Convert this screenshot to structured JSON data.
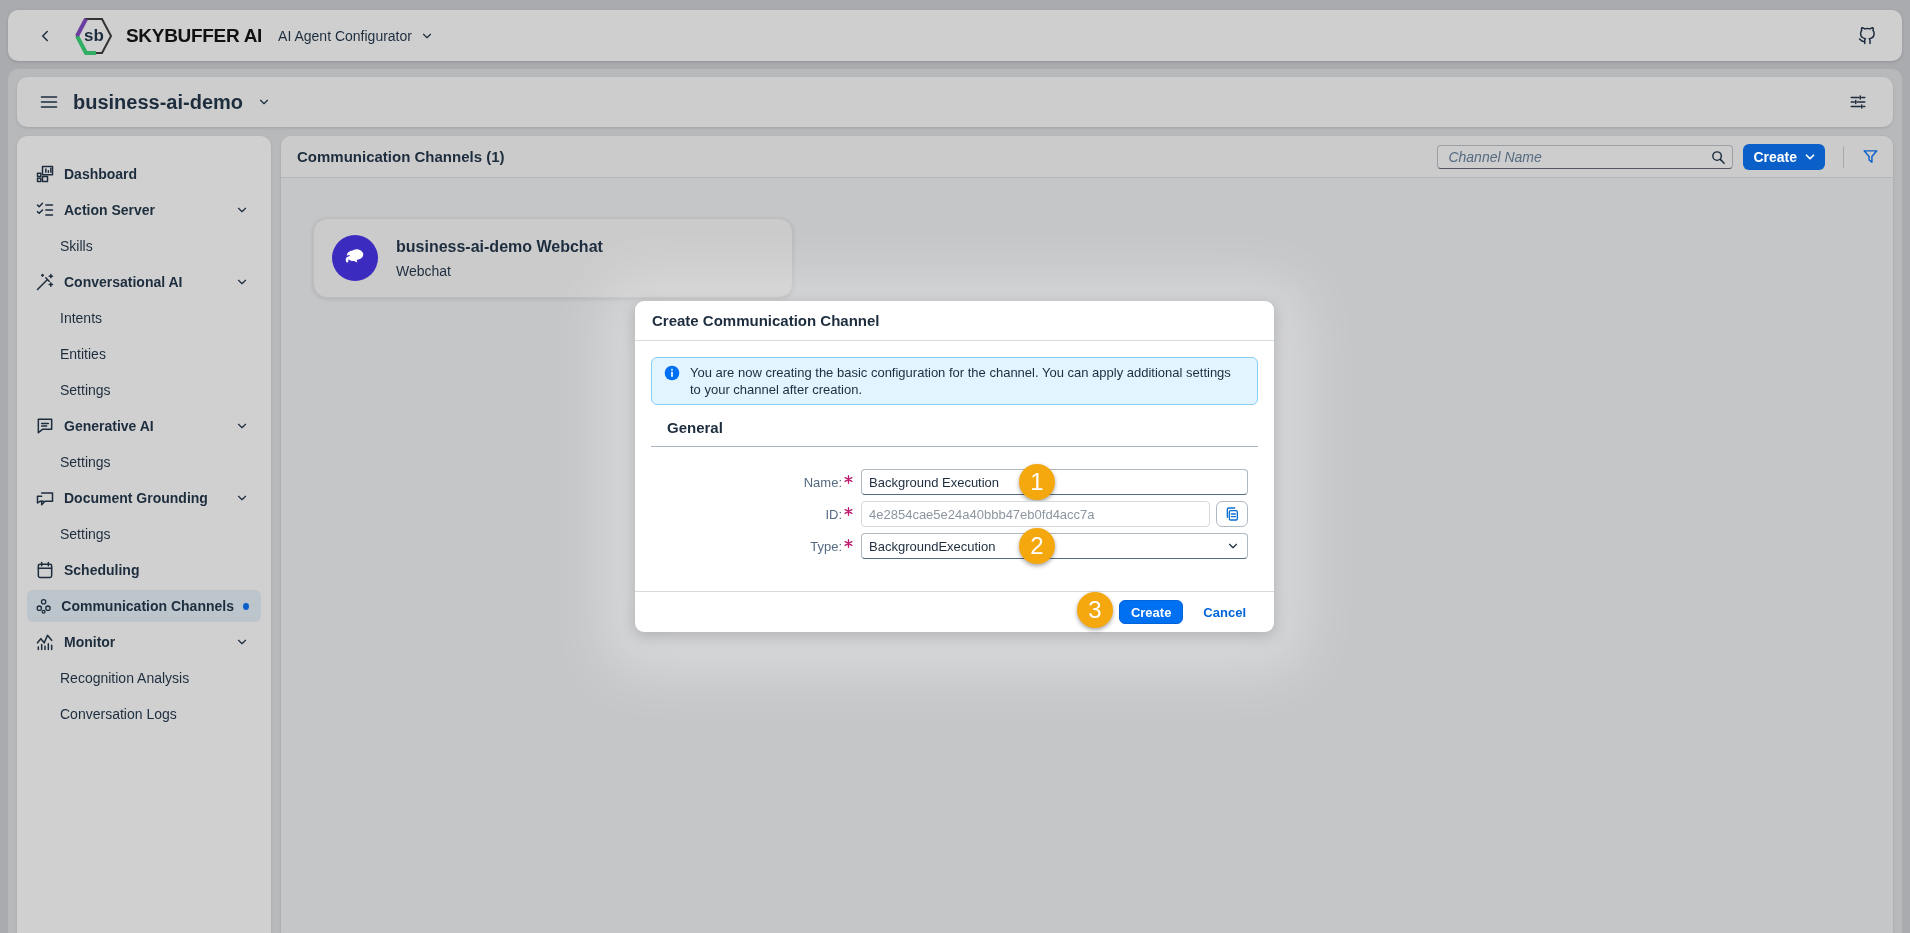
{
  "shell": {
    "logo_text": "sb",
    "title": "SKYBUFFER AI",
    "app": "AI Agent Configurator"
  },
  "subheader": {
    "title": "business-ai-demo"
  },
  "sidebar": {
    "items": [
      {
        "label": "Dashboard",
        "selected": false
      },
      {
        "label": "Action Server",
        "selected": false,
        "expanded": true,
        "children": [
          {
            "label": "Skills",
            "selected": false
          }
        ]
      },
      {
        "label": "Conversational AI",
        "selected": false,
        "expanded": true,
        "children": [
          {
            "label": "Intents",
            "selected": false
          },
          {
            "label": "Entities",
            "selected": false
          },
          {
            "label": "Settings",
            "selected": false
          }
        ]
      },
      {
        "label": "Generative AI",
        "selected": false,
        "expanded": true,
        "children": [
          {
            "label": "Settings",
            "selected": false
          }
        ]
      },
      {
        "label": "Document Grounding",
        "selected": false,
        "expanded": true,
        "children": [
          {
            "label": "Settings",
            "selected": false
          }
        ]
      },
      {
        "label": "Scheduling",
        "selected": false
      },
      {
        "label": "Communication Channels",
        "selected": true
      },
      {
        "label": "Monitor",
        "selected": false,
        "expanded": true,
        "children": [
          {
            "label": "Recognition Analysis",
            "selected": false
          },
          {
            "label": "Conversation Logs",
            "selected": false
          }
        ]
      }
    ]
  },
  "content": {
    "title": "Communication Channels (1)",
    "search": {
      "placeholder": "Channel Name"
    },
    "create_button": "Create",
    "cards": [
      {
        "title": "business-ai-demo Webchat",
        "subtitle": "Webchat"
      }
    ]
  },
  "dialog": {
    "title": "Create Communication Channel",
    "info": "You are now creating the basic configuration for the channel. You can apply additional settings to your channel after creation.",
    "section": "General",
    "fields": [
      {
        "kind": "input",
        "label": "Name:",
        "required": true,
        "value": "Background Execution",
        "step": "1"
      },
      {
        "kind": "readonly",
        "label": "ID:",
        "required": true,
        "value": "4e2854cae5e24a40bbb47eb0fd4acc7a"
      },
      {
        "kind": "select",
        "label": "Type:",
        "required": true,
        "value": "BackgroundExecution",
        "step": "2"
      }
    ],
    "buttons": [
      {
        "kind": "emphasized",
        "label": "Create",
        "step": "3"
      },
      {
        "kind": "transparent",
        "label": "Cancel"
      }
    ]
  }
}
